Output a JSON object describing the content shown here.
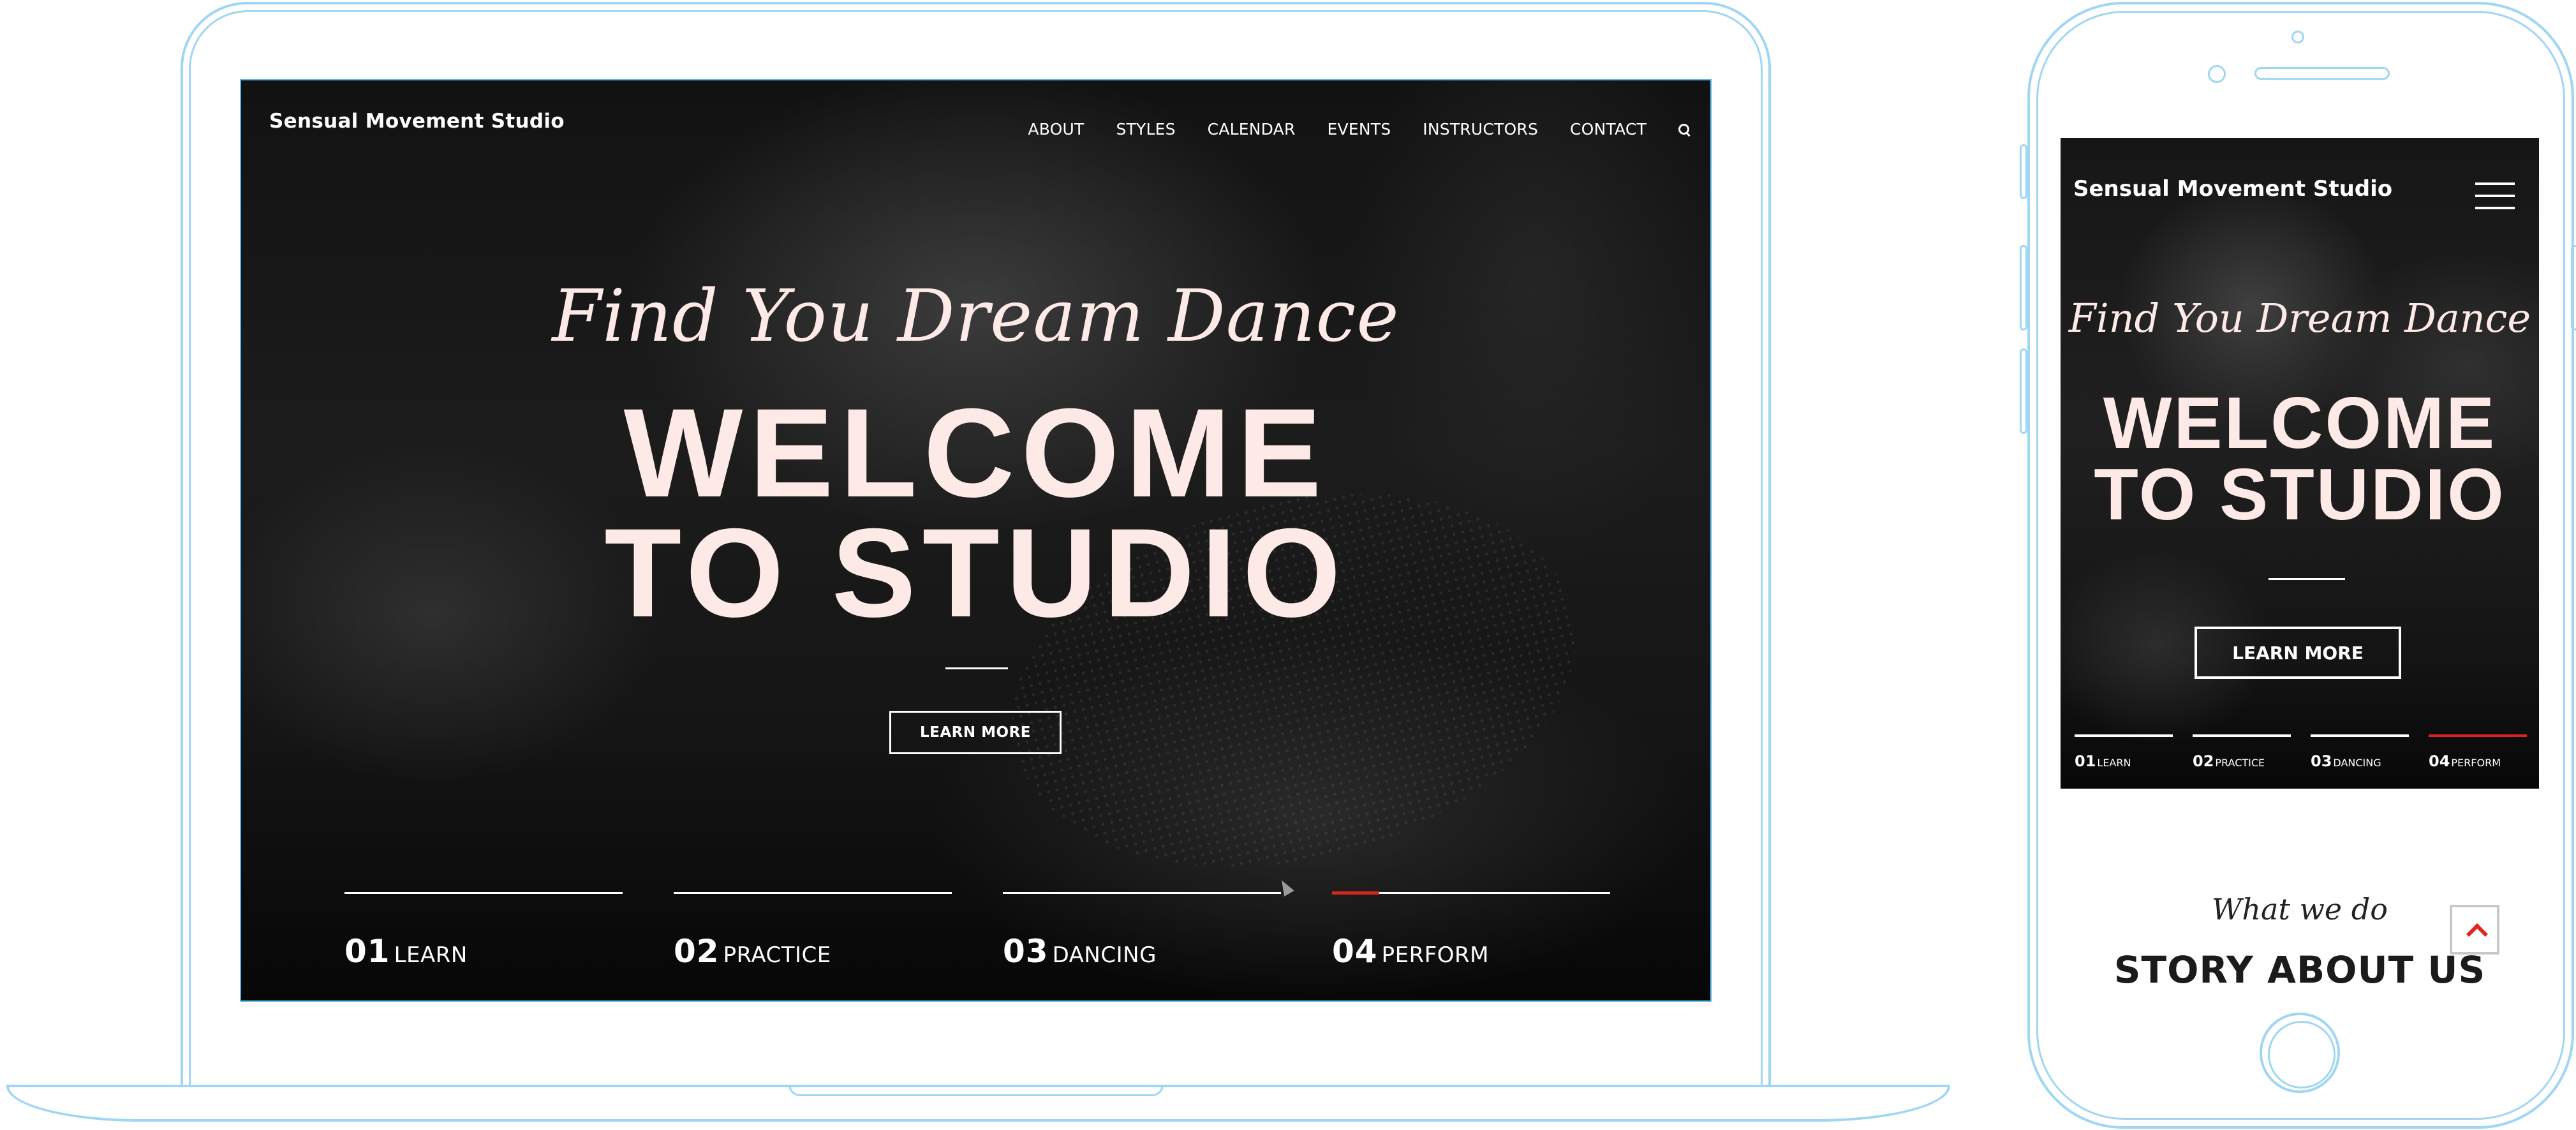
{
  "desktop": {
    "brand": "Sensual Movement Studio",
    "nav": [
      "ABOUT",
      "STYLES",
      "CALENDAR",
      "EVENTS",
      "INSTRUCTORS",
      "CONTACT"
    ],
    "search_icon": "search-icon",
    "hero": {
      "tagline": "Find You Dream Dance",
      "headline_line1": "WELCOME",
      "headline_line2": "TO STUDIO",
      "cta_label": "LEARN MORE"
    },
    "steps": [
      {
        "num": "01",
        "word": "LEARN"
      },
      {
        "num": "02",
        "word": "PRACTICE"
      },
      {
        "num": "03",
        "word": "DANCING"
      },
      {
        "num": "04",
        "word": "PERFORM"
      }
    ],
    "active_step": 4
  },
  "mobile": {
    "brand": "Sensual Movement Studio",
    "menu_icon": "hamburger-menu-icon",
    "hero": {
      "tagline": "Find You Dream Dance",
      "headline_line1": "WELCOME",
      "headline_line2": "TO STUDIO",
      "cta_label": "LEARN MORE"
    },
    "steps": [
      {
        "num": "01",
        "word": "LEARN"
      },
      {
        "num": "02",
        "word": "PRACTICE"
      },
      {
        "num": "03",
        "word": "DANCING"
      },
      {
        "num": "04",
        "word": "PERFORM"
      }
    ],
    "active_step": 4,
    "section_kicker": "What we do",
    "section_title": "STORY ABOUT US",
    "scroll_top_icon": "chevron-up-icon"
  },
  "colors": {
    "device_outline": "#9fd6f3",
    "hero_text": "#fde9e6",
    "accent_red": "#d7261e"
  }
}
